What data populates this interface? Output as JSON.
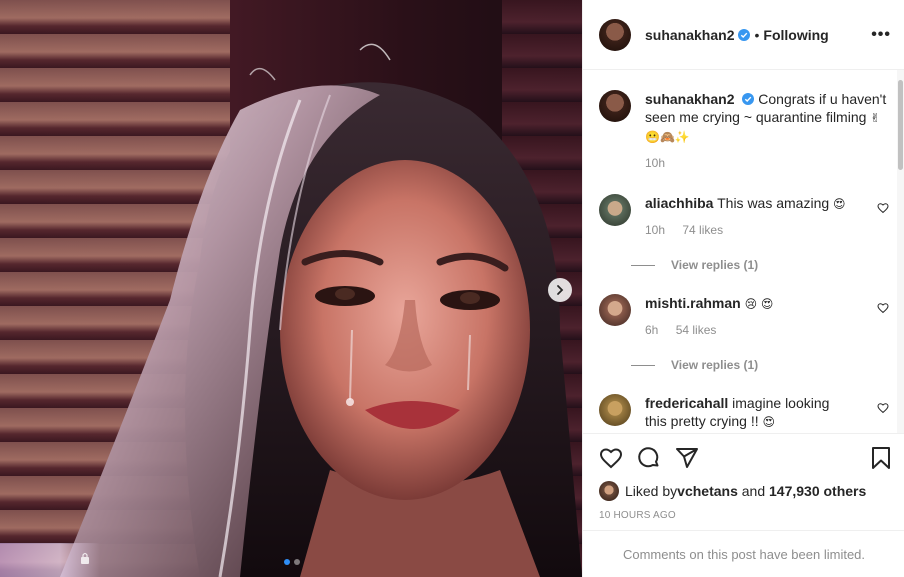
{
  "post": {
    "image_alt": "",
    "carousel": {
      "total": 2,
      "active": 0
    }
  },
  "header": {
    "username": "suhanakhan2",
    "separator": "•",
    "follow_status": "Following",
    "more_label": "•••"
  },
  "caption": {
    "username": "suhanakhan2",
    "text": "Congrats if u haven't seen me crying ~ quarantine filming",
    "emojis": "✌😬🙈✨",
    "time": "10h"
  },
  "comments": [
    {
      "username": "aliachhiba",
      "text": "This was amazing",
      "emojis": "😍",
      "time": "10h",
      "likes": "74 likes",
      "view_replies": "View replies (1)"
    },
    {
      "username": "mishti.rahman",
      "text": "",
      "emojis": "😢 😍",
      "time": "6h",
      "likes": "54 likes",
      "view_replies": "View replies (1)"
    },
    {
      "username": "fredericahall",
      "text": "imagine looking this pretty crying !!",
      "emojis": "😍",
      "time": "",
      "likes": "",
      "view_replies": ""
    }
  ],
  "actions": {
    "like_icon": "heart-icon",
    "comment_icon": "comment-icon",
    "share_icon": "share-icon",
    "save_icon": "bookmark-icon"
  },
  "likes": {
    "prefix": "Liked by ",
    "user": "vchetans",
    "middle": " and ",
    "count": "147,930 others"
  },
  "timestamp": "10 HOURS AGO",
  "comments_limited": "Comments on this post have been limited.",
  "colors": {
    "verified": "#3897f0",
    "muted": "#8e8e8e",
    "dot_active": "#2f8ef6"
  }
}
